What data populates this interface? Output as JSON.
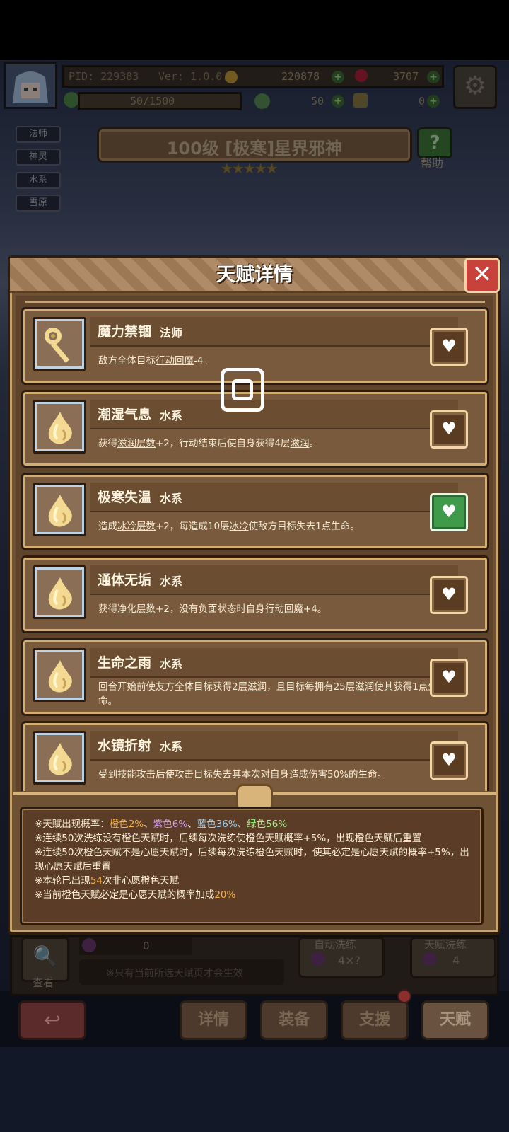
{
  "header": {
    "pid": "PID: 229383",
    "version": "Ver: 1.0.0.9",
    "gold": "220878",
    "gems": "3707",
    "stamina": "50/1500",
    "clover": "50",
    "tokens": "0"
  },
  "tags": [
    "法师",
    "神灵",
    "水系",
    "雪原"
  ],
  "character": {
    "title": "100级 [极寒]星界邪神",
    "help_label": "帮助",
    "stars": 5
  },
  "modal": {
    "title": "天赋详情",
    "close_label": "✕"
  },
  "talents": [
    {
      "name": "魔力禁锢",
      "category": "法师",
      "desc_parts": [
        {
          "t": "敌方全体目标"
        },
        {
          "t": "行动回魔",
          "u": true
        },
        {
          "t": "-4。"
        }
      ],
      "favorite": false,
      "icon": "staff-icon"
    },
    {
      "name": "潮湿气息",
      "category": "水系",
      "desc_parts": [
        {
          "t": "获得"
        },
        {
          "t": "滋润层数",
          "u": true
        },
        {
          "t": "+2，行动结束后使自身获得4层"
        },
        {
          "t": "滋润",
          "u": true
        },
        {
          "t": "。"
        }
      ],
      "favorite": false,
      "icon": "water-drop-icon"
    },
    {
      "name": "极寒失温",
      "category": "水系",
      "desc_parts": [
        {
          "t": "造成"
        },
        {
          "t": "冰冷层数",
          "u": true
        },
        {
          "t": "+2，每造成10层"
        },
        {
          "t": "冰冷",
          "u": true
        },
        {
          "t": "使敌方目标失去1点生命。"
        }
      ],
      "favorite": true,
      "icon": "water-drop-icon"
    },
    {
      "name": "通体无垢",
      "category": "水系",
      "desc_parts": [
        {
          "t": "获得"
        },
        {
          "t": "净化层数",
          "u": true
        },
        {
          "t": "+2，没有负面状态时自身"
        },
        {
          "t": "行动回魔",
          "u": true
        },
        {
          "t": "+4。"
        }
      ],
      "favorite": false,
      "icon": "water-drop-icon"
    },
    {
      "name": "生命之雨",
      "category": "水系",
      "desc_parts": [
        {
          "t": "回合开始前使友方全体目标获得2层"
        },
        {
          "t": "滋润",
          "u": true
        },
        {
          "t": "，且目标每拥有25层"
        },
        {
          "t": "滋润",
          "u": true
        },
        {
          "t": "使其获得1点生命。"
        }
      ],
      "favorite": false,
      "icon": "water-drop-icon"
    },
    {
      "name": "水镜折射",
      "category": "水系",
      "desc_parts": [
        {
          "t": "受到技能攻击后使攻击目标失去其本次对自身造成伤害50%的生命。"
        }
      ],
      "favorite": false,
      "icon": "water-drop-icon"
    }
  ],
  "info": {
    "line1_prefix": "※天赋出现概率：",
    "orange": "橙色2%",
    "sep1": "、",
    "purple": "紫色6%",
    "sep2": "、",
    "blue": "蓝色36%",
    "sep3": "、",
    "green": "绿色56%",
    "line2": "※连续50次洗练没有橙色天赋时，后续每次洗练使橙色天赋概率+5%，出现橙色天赋后重置",
    "line3": "※连续50次橙色天赋不是心愿天赋时，后续每次洗练橙色天赋时，使其必定是心愿天赋的概率+5%，出现心愿天赋后重置",
    "line4_prefix": "※本轮已出现",
    "line4_count": "54",
    "line4_suffix": "次非心愿橙色天赋",
    "line5_prefix": "※当前橙色天赋必定是心愿天赋的概率加成",
    "line5_value": "20%"
  },
  "behind": {
    "view_label": "查看",
    "potion_count": "0",
    "note": "※只有当前所选天赋页才会生效",
    "auto_refine_label": "自动洗练",
    "auto_refine_cost": "4×?",
    "talent_refine_label": "天赋洗练",
    "talent_refine_cost": "4"
  },
  "nav": {
    "details": "详情",
    "equip": "装备",
    "support": "支援",
    "talent": "天赋"
  },
  "colors": {
    "orange": "#f7b14c",
    "purple": "#d39af2",
    "blue": "#9dd2f7",
    "green": "#a9eb86",
    "favorite_active": "#3f9b49",
    "close": "#c8413b"
  }
}
